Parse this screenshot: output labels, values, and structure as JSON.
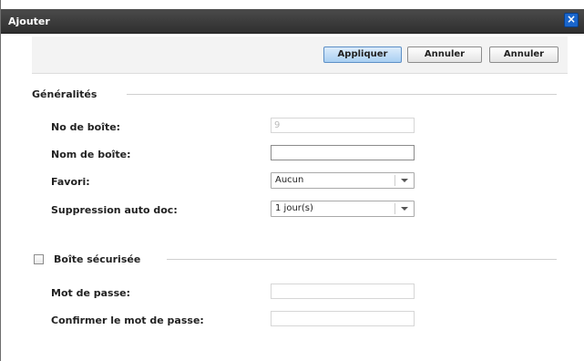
{
  "dialog": {
    "title": "Ajouter",
    "close_icon": "×"
  },
  "toolbar": {
    "apply_label": "Appliquer",
    "cancel_label_1": "Annuler",
    "cancel_label_2": "Annuler"
  },
  "general": {
    "section_title": "Généralités",
    "box_number_label": "No de boîte:",
    "box_number_value": "9",
    "box_name_label": "Nom de boîte:",
    "box_name_value": "",
    "favorite_label": "Favori:",
    "favorite_value": "Aucun",
    "auto_delete_label": "Suppression auto doc:",
    "auto_delete_value": "1 jour(s)"
  },
  "secure": {
    "section_title": "Boîte sécurisée",
    "checked": false,
    "password_label": "Mot de passe:",
    "confirm_label": "Confirmer le mot de passe:"
  }
}
